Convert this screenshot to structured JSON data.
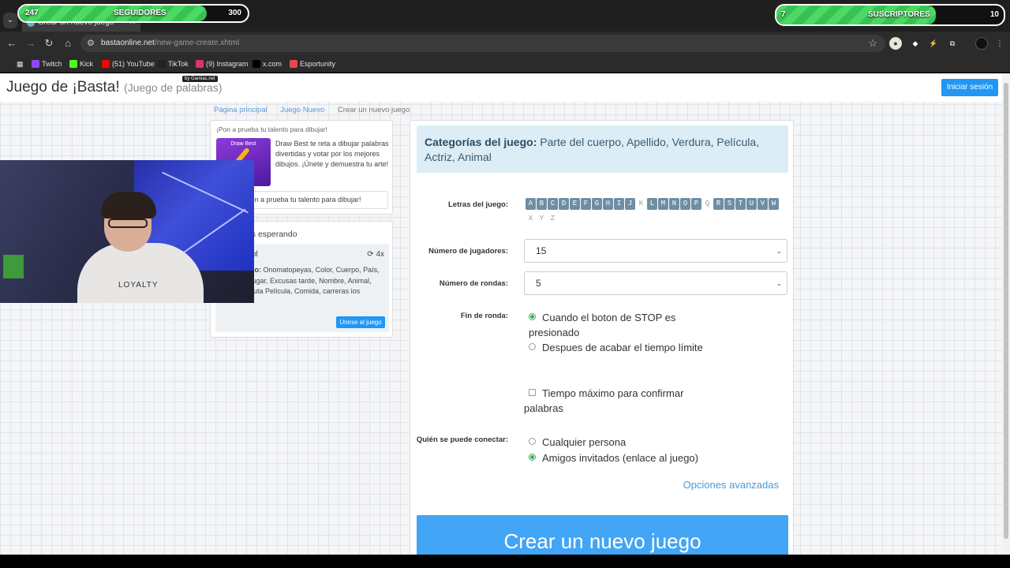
{
  "overlay": {
    "followers": {
      "current": "247",
      "label": "SEGUIDORES",
      "goal": "300",
      "progress": 0.82
    },
    "subscribers": {
      "current": "7",
      "label": "SUSCRIPTORES",
      "goal": "10",
      "progress": 0.7
    }
  },
  "browser": {
    "tab_title": "Crear un nuevo juego",
    "url_host": "bastaonline.net",
    "url_path": "/new-game-create.xhtml",
    "bookmarks": [
      {
        "label": "Twitch",
        "color": "#9146ff"
      },
      {
        "label": "Kick",
        "color": "#53fc18"
      },
      {
        "label": "(51) YouTube",
        "color": "#ff0000"
      },
      {
        "label": "TikTok",
        "color": "#222222"
      },
      {
        "label": "(9) Instagram",
        "color": "#e1306c"
      },
      {
        "label": "x.com",
        "color": "#000000"
      },
      {
        "label": "Esportunity",
        "color": "#e5484d"
      }
    ]
  },
  "header": {
    "title": "Juego de ¡Basta!",
    "subtitle": "(Juego de palabras)",
    "badge": "by Gamiac.net",
    "login_button": "Iniciar sesión"
  },
  "breadcrumb": [
    "Página principal",
    "Juego Nuevo",
    "Crear un nuevo juego"
  ],
  "promo": {
    "title": "¡Pon a prueba tu talento para dibujar!",
    "image_label": "Draw Best",
    "text": "Draw Best te reta a dibujar palabras divertidas y votar por los mejores dibujos. ¡Únete y demuestra tu arte!",
    "button": "¡Pon a prueba tu talento para dibujar!"
  },
  "waiting": {
    "title": "Jugadores esperando",
    "game": {
      "host": "ol",
      "count": "4x",
      "cats_label": "s del juego:",
      "cats_text": "Onomatopeyas, Color, Cuerpo, País, ciudad o lugar, Excusas tarde, Nombre, Animal, Objeto, Fruta Película, Comida, carreras ios",
      "join_button": "Unirse al juego"
    }
  },
  "webcam": {
    "shirt_text": "LOYALTY"
  },
  "main": {
    "categories_label": "Categorías del juego:",
    "categories": "Parte del cuerpo, Apellido, Verdura, Película, Actriz, Animal",
    "letters_label": "Letras del juego:",
    "letters": [
      {
        "l": "A",
        "on": true
      },
      {
        "l": "B",
        "on": true
      },
      {
        "l": "C",
        "on": true
      },
      {
        "l": "D",
        "on": true
      },
      {
        "l": "E",
        "on": true
      },
      {
        "l": "F",
        "on": true
      },
      {
        "l": "G",
        "on": true
      },
      {
        "l": "H",
        "on": true
      },
      {
        "l": "I",
        "on": true
      },
      {
        "l": "J",
        "on": true
      },
      {
        "l": "K",
        "on": false
      },
      {
        "l": "L",
        "on": true
      },
      {
        "l": "M",
        "on": true
      },
      {
        "l": "N",
        "on": true
      },
      {
        "l": "O",
        "on": true
      },
      {
        "l": "P",
        "on": true
      },
      {
        "l": "Q",
        "on": false
      },
      {
        "l": "R",
        "on": true
      },
      {
        "l": "S",
        "on": true
      },
      {
        "l": "T",
        "on": true
      },
      {
        "l": "U",
        "on": true
      },
      {
        "l": "V",
        "on": true
      },
      {
        "l": "W",
        "on": true
      },
      {
        "l": "X",
        "on": false
      },
      {
        "l": "Y",
        "on": false
      },
      {
        "l": "Z",
        "on": false
      }
    ],
    "players_label": "Número de jugadores:",
    "players_value": "15",
    "rounds_label": "Número de rondas:",
    "rounds_value": "5",
    "round_end_label": "Fin de ronda:",
    "round_end_options": [
      "Cuando el boton de STOP es presionado",
      "Despues de acabar el tiempo límite"
    ],
    "confirm_time_option": "Tiempo máximo para confirmar palabras",
    "who_label": "Quién se puede conectar:",
    "who_options": [
      "Cualquier persona",
      "Amigos invitados (enlace al juego)"
    ],
    "advanced_link": "Opciones avanzadas",
    "create_button": "Crear un nuevo juego"
  }
}
